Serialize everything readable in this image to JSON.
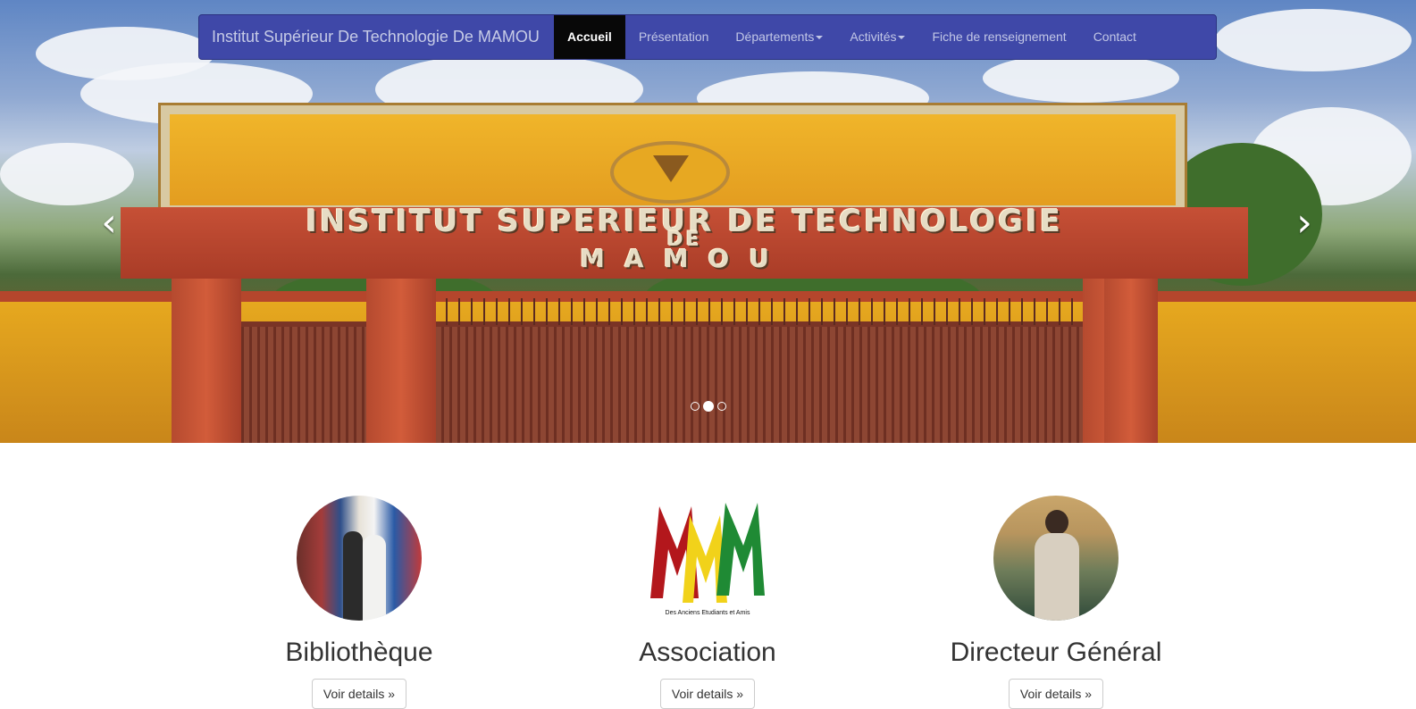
{
  "navbar": {
    "brand": "Institut Supérieur De Technologie De MAMOU",
    "items": [
      {
        "label": "Accueil",
        "active": true,
        "dropdown": false
      },
      {
        "label": "Présentation",
        "active": false,
        "dropdown": false
      },
      {
        "label": "Départements",
        "active": false,
        "dropdown": true
      },
      {
        "label": "Activités",
        "active": false,
        "dropdown": true
      },
      {
        "label": "Fiche de renseignement",
        "active": false,
        "dropdown": false
      },
      {
        "label": "Contact",
        "active": false,
        "dropdown": false
      }
    ]
  },
  "carousel": {
    "sign_line1": "INSTITUT SUPERIEUR DE TECHNOLOGIE",
    "sign_line2": "DE",
    "sign_line3": "MAMOU",
    "prev_icon": "chevron-left-icon",
    "next_icon": "chevron-right-icon",
    "slide_count": 3,
    "active_slide": 2
  },
  "features": [
    {
      "title": "Bibliothèque",
      "button": "Voir details »"
    },
    {
      "title": "Association",
      "button": "Voir details »",
      "logo_caption": "Des Anciens Etudiants et Amis"
    },
    {
      "title": "Directeur Général",
      "button": "Voir details »"
    }
  ],
  "colors": {
    "navbar_bg": "#3f48a8",
    "navbar_active": "#080808",
    "logo_red": "#b3171c",
    "logo_yellow": "#f1d21a",
    "logo_green": "#1f8a34"
  }
}
